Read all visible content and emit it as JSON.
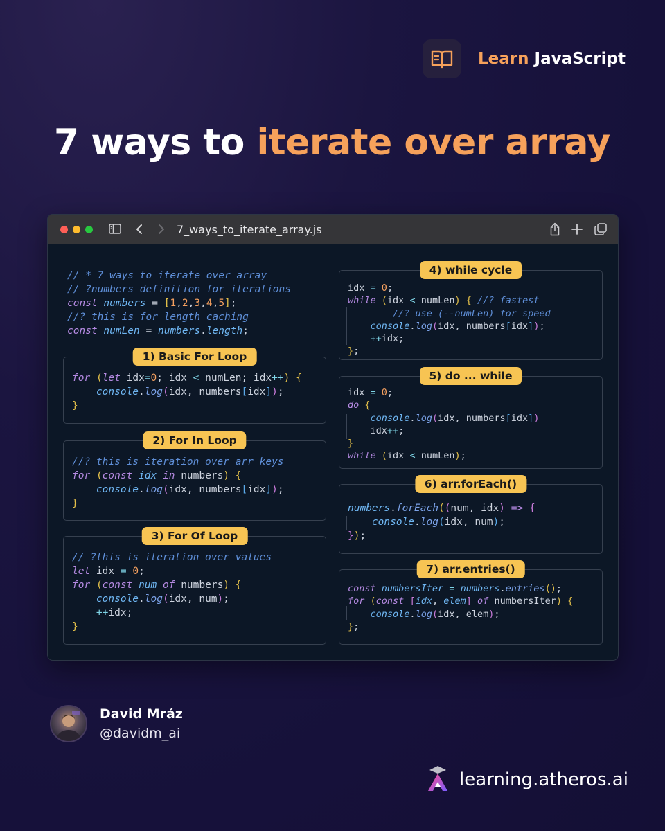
{
  "brand": {
    "accent_word": "Learn",
    "rest": "JavaScript",
    "icon": "open-book-icon"
  },
  "title": {
    "plain": "7 ways to",
    "accent": "iterate over array"
  },
  "window": {
    "filename": "7_ways_to_iterate_array.js",
    "icons": [
      "close-dot",
      "minimize-dot",
      "zoom-dot",
      "sidebar-icon",
      "back-arrow-icon",
      "forward-arrow-icon",
      "share-icon",
      "new-tab-plus-icon",
      "tabs-overview-icon"
    ]
  },
  "code": {
    "header": [
      "// * 7 ways to iterate over array",
      "// ?numbers definition for iterations",
      "const numbers = [1,2,3,4,5];",
      "//? this is for length caching",
      "const numLen = numbers.length;"
    ],
    "blocks": [
      {
        "label": "1) Basic For Loop",
        "lines": [
          "for (let idx=0; idx < numLen; idx++) {",
          "    console.log(idx, numbers[idx]);",
          "}"
        ]
      },
      {
        "label": "2) For In Loop",
        "lines": [
          "//? this is iteration over arr keys",
          "for (const idx in numbers) {",
          "    console.log(idx, numbers[idx]);",
          "}"
        ]
      },
      {
        "label": "3) For Of Loop",
        "lines": [
          "// ?this is iteration over values",
          "let idx = 0;",
          "for (const num of numbers) {",
          "    console.log(idx, num);",
          "    ++idx;",
          "}"
        ]
      },
      {
        "label": "4) while cycle",
        "lines": [
          "idx = 0;",
          "while (idx < numLen) { //? fastest",
          "    //? use (--numLen) for speed",
          "    console.log(idx, numbers[idx]);",
          "    ++idx;",
          "};"
        ]
      },
      {
        "label": "5) do ... while",
        "lines": [
          "idx = 0;",
          "do {",
          "    console.log(idx, numbers[idx])",
          "    idx++;",
          "}",
          "while (idx < numLen);"
        ]
      },
      {
        "label": "6) arr.forEach()",
        "lines": [
          "numbers.forEach((num, idx) => {",
          "    console.log(idx, num);",
          "});"
        ]
      },
      {
        "label": "7) arr.entries()",
        "lines": [
          "const numbersIter = numbers.entries();",
          "for (const [idx, elem] of numbersIter) {",
          "    console.log(idx, elem);",
          "};"
        ]
      }
    ]
  },
  "author": {
    "name": "David Mráz",
    "handle": "@davidm_ai"
  },
  "site": {
    "url": "learning.atheros.ai",
    "logo": "atheros-logo"
  },
  "colors": {
    "accent": "#f6a15b",
    "badge": "#f7c453",
    "background": "#1b1540",
    "window_bg": "#0c1726"
  }
}
